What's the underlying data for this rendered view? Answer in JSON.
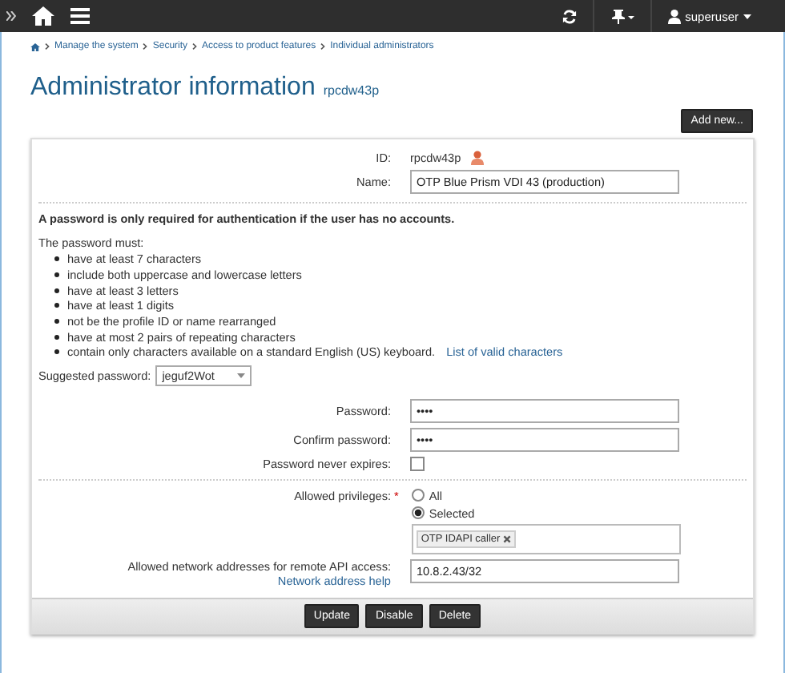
{
  "topbar": {
    "user": "superuser"
  },
  "breadcrumb": [
    "Manage the system",
    "Security",
    "Access to product features",
    "Individual administrators"
  ],
  "title": "Administrator information",
  "subtitle": "rpcdw43p",
  "add_button": "Add new...",
  "id_field": {
    "label": "ID:",
    "value": "rpcdw43p"
  },
  "name_field": {
    "label": "Name:",
    "value": "OTP Blue Prism VDI 43 (production)"
  },
  "password_note": "A password is only required for authentication if the user has no accounts.",
  "rules_title": "The password must:",
  "rules": [
    "have at least 7 characters",
    "include both uppercase and lowercase letters",
    "have at least 3 letters",
    "have at least 1 digits",
    "not be the profile ID or name rearranged",
    "have at most 2 pairs of repeating characters",
    "contain only characters available on a standard English (US) keyboard."
  ],
  "rules_link": "List of valid characters",
  "suggested": {
    "label": "Suggested password:",
    "value": "jeguf2Wot"
  },
  "password": {
    "label": "Password:",
    "value": "••••"
  },
  "confirm": {
    "label": "Confirm password:",
    "value": "••••"
  },
  "never_expires": {
    "label": "Password never expires:",
    "checked": false
  },
  "privileges": {
    "label": "Allowed privileges:",
    "required_mark": "*",
    "options": [
      {
        "label": "All",
        "selected": false
      },
      {
        "label": "Selected",
        "selected": true
      }
    ],
    "tags": [
      "OTP IDAPI caller"
    ]
  },
  "network": {
    "label": "Allowed network addresses for remote API access:",
    "help": "Network address help",
    "value": "10.8.2.43/32"
  },
  "buttons": [
    "Update",
    "Disable",
    "Delete"
  ]
}
